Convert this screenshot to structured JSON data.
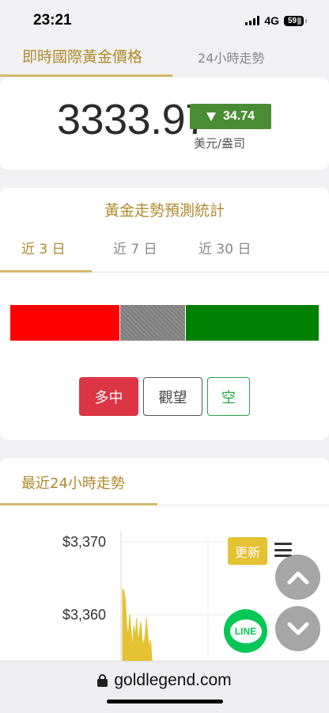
{
  "status_bar": {
    "time": "23:21",
    "network": "4G",
    "battery": "59"
  },
  "top_tabs": {
    "active": "即時國際黃金價格",
    "inactive": "24小時走勢"
  },
  "price": {
    "value": "3333.97",
    "change": "34.74",
    "unit": "美元/盎司",
    "change_color": "#4a8c34"
  },
  "forecast": {
    "title": "黃金走勢預測統計",
    "tabs": [
      "近 3 日",
      "近 7 日",
      "近 30 日"
    ],
    "active_tab": 0,
    "distribution": [
      {
        "key": "bull",
        "share": 0.355,
        "color": "#ff0000"
      },
      {
        "key": "neutral",
        "share": 0.215,
        "color": "#858585"
      },
      {
        "key": "bear",
        "share": 0.43,
        "color": "#008000"
      }
    ],
    "legend": {
      "bull": "多中",
      "neutral": "觀望",
      "bear": "空"
    }
  },
  "history": {
    "title": "最近24小時走勢",
    "update_label": "更新",
    "line_label": "LINE"
  },
  "chart_data": {
    "type": "area",
    "title": "",
    "xlabel": "",
    "ylabel": "",
    "y_tick_labels": [
      "$3,370",
      "$3,360"
    ],
    "y_ticks": [
      3370,
      3360
    ],
    "ylim": [
      3352,
      3372
    ],
    "series": [
      {
        "color": "#e4c234",
        "x": [
          0,
          1,
          2,
          3,
          4,
          5,
          6,
          7,
          8,
          9,
          10,
          11,
          12,
          13,
          14,
          15,
          16,
          17,
          18,
          19,
          20,
          21,
          22
        ],
        "values": [
          3363.5,
          3363.2,
          3362.0,
          3358.5,
          3357.0,
          3360.0,
          3358.0,
          3355.5,
          3358.5,
          3357.0,
          3359.5,
          3356.5,
          3357.5,
          3359.0,
          3356.5,
          3356.0,
          3357.0,
          3359.5,
          3357.0,
          3355.5,
          3356.5,
          3353.5,
          3353.0
        ]
      }
    ],
    "grid": true
  },
  "browser": {
    "url": "goldlegend.com"
  }
}
